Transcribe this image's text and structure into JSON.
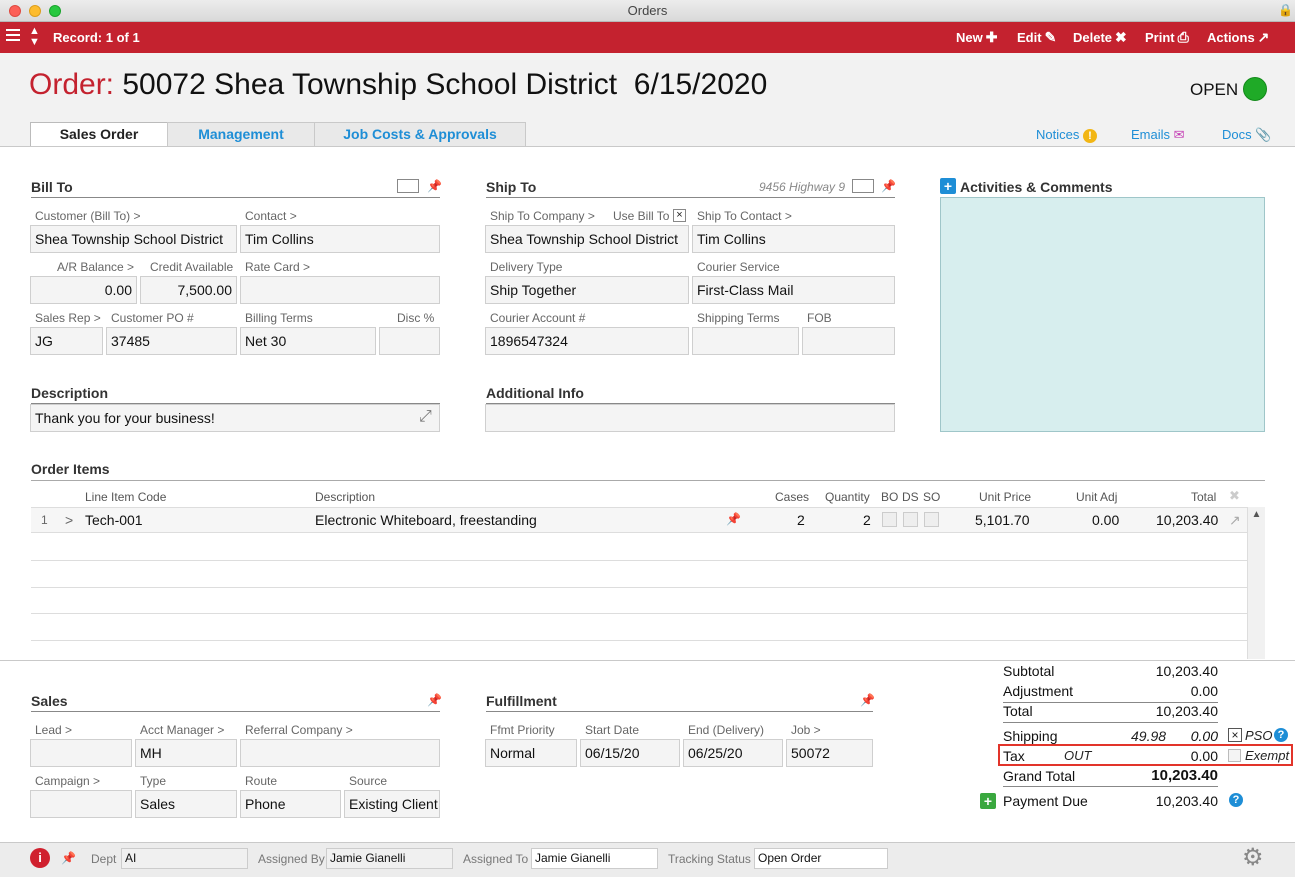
{
  "window": {
    "title": "Orders"
  },
  "toolbar": {
    "record": "Record: 1 of 1",
    "new": "New",
    "edit": "Edit",
    "delete": "Delete",
    "print": "Print",
    "actions": "Actions"
  },
  "header": {
    "order_label": "Order:",
    "order_title": "50072 Shea Township School District",
    "order_date": "6/15/2020",
    "status": "OPEN",
    "status_color": "#1faa27"
  },
  "tabs": [
    "Sales Order",
    "Management",
    "Job Costs & Approvals"
  ],
  "header_links": {
    "notices": "Notices",
    "emails": "Emails",
    "docs": "Docs"
  },
  "bill_to": {
    "title": "Bill To",
    "customer_label": "Customer (Bill To) >",
    "customer": "Shea Township School District",
    "contact_label": "Contact >",
    "contact": "Tim Collins",
    "ar_label": "A/R Balance >",
    "ar": "0.00",
    "credit_label": "Credit Available",
    "credit": "7,500.00",
    "rate_label": "Rate Card >",
    "rate": "",
    "rep_label": "Sales Rep >",
    "rep": "JG",
    "po_label": "Customer PO #",
    "po": "37485",
    "terms_label": "Billing Terms",
    "terms": "Net 30",
    "disc_label": "Disc %",
    "disc": ""
  },
  "ship_to": {
    "title": "Ship To",
    "address_hint": "9456 Highway 9",
    "company_label": "Ship To Company >",
    "company": "Shea Township School District",
    "use_bill_label": "Use Bill To",
    "use_bill_mark": "×",
    "contact_label": "Ship To Contact >",
    "contact": "Tim Collins",
    "delivery_label": "Delivery Type",
    "delivery": "Ship Together",
    "courier_label": "Courier Service",
    "courier": "First-Class Mail",
    "account_label": "Courier Account #",
    "account": "1896547324",
    "ship_terms_label": "Shipping Terms",
    "ship_terms": "",
    "fob_label": "FOB",
    "fob": ""
  },
  "activities": {
    "title": "Activities & Comments"
  },
  "description": {
    "title": "Description",
    "value": "Thank you for your business!"
  },
  "additional": {
    "title": "Additional Info",
    "value": ""
  },
  "order_items": {
    "title": "Order Items",
    "headers": {
      "code": "Line Item Code",
      "desc": "Description",
      "cases": "Cases",
      "qty": "Quantity",
      "bo": "BO",
      "ds": "DS",
      "so": "SO",
      "price": "Unit Price",
      "adj": "Unit Adj",
      "total": "Total"
    },
    "rows": [
      {
        "num": "1",
        "code": "Tech-001",
        "desc": "Electronic Whiteboard, freestanding",
        "cases": "2",
        "qty": "2",
        "price": "5,101.70",
        "adj": "0.00",
        "total": "10,203.40"
      }
    ]
  },
  "sales": {
    "title": "Sales",
    "lead_label": "Lead >",
    "lead": "",
    "acct_label": "Acct Manager >",
    "acct": "MH",
    "referral_label": "Referral Company >",
    "referral": "",
    "campaign_label": "Campaign >",
    "campaign": "",
    "type_label": "Type",
    "type": "Sales",
    "route_label": "Route",
    "route": "Phone",
    "source_label": "Source",
    "source": "Existing Client"
  },
  "fulfillment": {
    "title": "Fulfillment",
    "priority_label": "Ffmt Priority",
    "priority": "Normal",
    "start_label": "Start Date",
    "start": "06/15/20",
    "end_label": "End (Delivery)",
    "end": "06/25/20",
    "job_label": "Job >",
    "job": "50072"
  },
  "totals": {
    "subtotal_label": "Subtotal",
    "subtotal": "10,203.40",
    "adjustment_label": "Adjustment",
    "adjustment": "0.00",
    "total_label": "Total",
    "total": "10,203.40",
    "shipping_label": "Shipping",
    "shipping_cost": "49.98",
    "shipping": "0.00",
    "pso": "PSO",
    "pso_mark": "×",
    "tax_label": "Tax",
    "tax_code": "OUT",
    "tax": "0.00",
    "exempt": "Exempt",
    "grand_label": "Grand Total",
    "grand": "10,203.40",
    "payment_label": "Payment Due",
    "payment": "10,203.40"
  },
  "footer": {
    "dept_label": "Dept",
    "dept": "AI",
    "assigned_by_label": "Assigned By",
    "assigned_by": "Jamie Gianelli",
    "assigned_to_label": "Assigned To",
    "assigned_to": "Jamie Gianelli",
    "tracking_label": "Tracking Status",
    "tracking": "Open Order"
  }
}
